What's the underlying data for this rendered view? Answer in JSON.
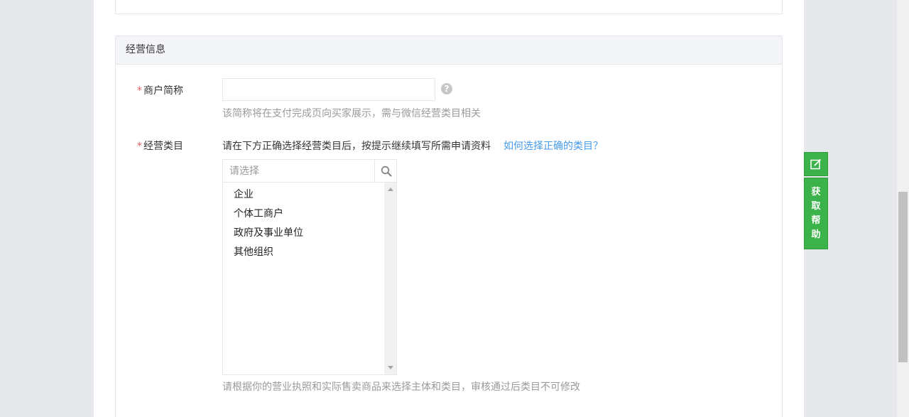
{
  "section": {
    "title": "经营信息"
  },
  "merchant_name": {
    "label": "商户简称",
    "required_mark": "*",
    "value": "",
    "placeholder": "",
    "help_icon": "question-icon",
    "hint": "该简称将在支付完成页向买家展示，需与微信经营类目相关"
  },
  "category": {
    "label": "经营类目",
    "required_mark": "*",
    "instruction": "请在下方正确选择经营类目后，按提示继续填写所需申请资料",
    "link": "如何选择正确的类目？",
    "search_placeholder": "请选择",
    "search_icon": "search-icon",
    "options": [
      "企业",
      "个体工商户",
      "政府及事业单位",
      "其他组织"
    ],
    "hint": "请根据你的营业执照和实际售卖商品来选择主体和类目，审核通过后类目不可修改"
  },
  "floating": {
    "edit_icon": "edit-icon",
    "help_chars": [
      "获",
      "取",
      "帮",
      "助"
    ]
  },
  "colors": {
    "required": "#e15f63",
    "link": "#459ae9",
    "float_green": "#3cb34a",
    "hint": "#9a9a9a"
  }
}
